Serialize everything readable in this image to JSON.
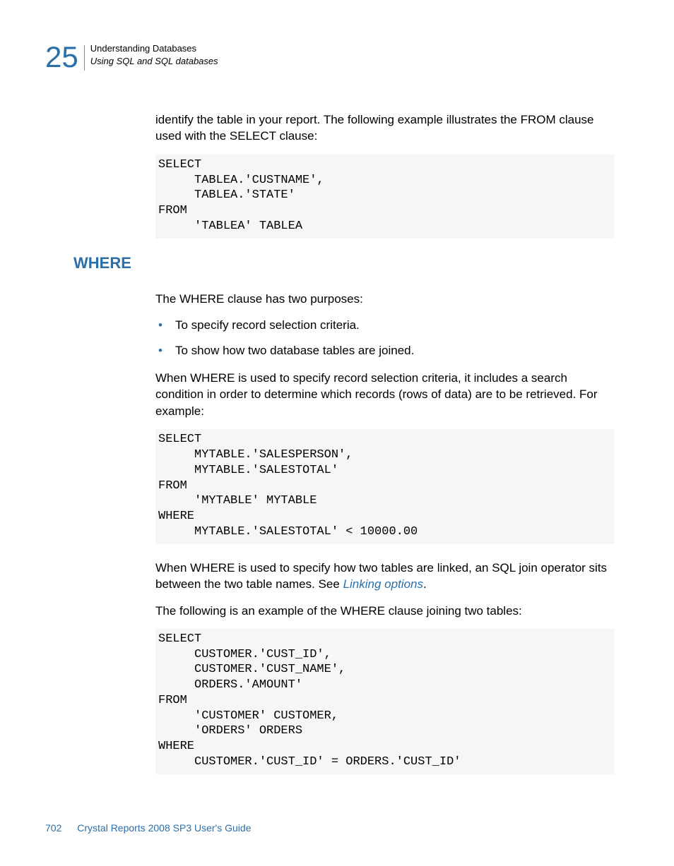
{
  "header": {
    "chapter_number": "25",
    "title": "Understanding Databases",
    "subtitle": "Using SQL and SQL databases"
  },
  "body": {
    "intro_para": "identify the table in your report. The following example illustrates the FROM clause used with the SELECT clause:",
    "code1": "SELECT\n     TABLEA.'CUSTNAME',\n     TABLEA.'STATE'\nFROM\n     'TABLEA' TABLEA",
    "section_heading": "WHERE",
    "where_intro": "The WHERE clause has two purposes:",
    "bullets": [
      "To specify record selection criteria.",
      "To show how two database tables are joined."
    ],
    "where_para2": "When WHERE is used to specify record selection criteria, it includes a search condition in order to determine which records (rows of data) are to be retrieved. For example:",
    "code2": "SELECT\n     MYTABLE.'SALESPERSON',\n     MYTABLE.'SALESTOTAL'\nFROM\n     'MYTABLE' MYTABLE\nWHERE\n     MYTABLE.'SALESTOTAL' < 10000.00",
    "where_para3_pre": "When WHERE is used to specify how two tables are linked, an SQL join operator sits between the two table names. See ",
    "where_para3_link": "Linking options",
    "where_para3_post": ".",
    "where_para4": "The following is an example of the WHERE clause joining two tables:",
    "code3": "SELECT\n     CUSTOMER.'CUST_ID',\n     CUSTOMER.'CUST_NAME',\n     ORDERS.'AMOUNT'\nFROM\n     'CUSTOMER' CUSTOMER,\n     'ORDERS' ORDERS\nWHERE\n     CUSTOMER.'CUST_ID' = ORDERS.'CUST_ID'"
  },
  "footer": {
    "page_number": "702",
    "doc_title": "Crystal Reports 2008 SP3 User's Guide"
  }
}
